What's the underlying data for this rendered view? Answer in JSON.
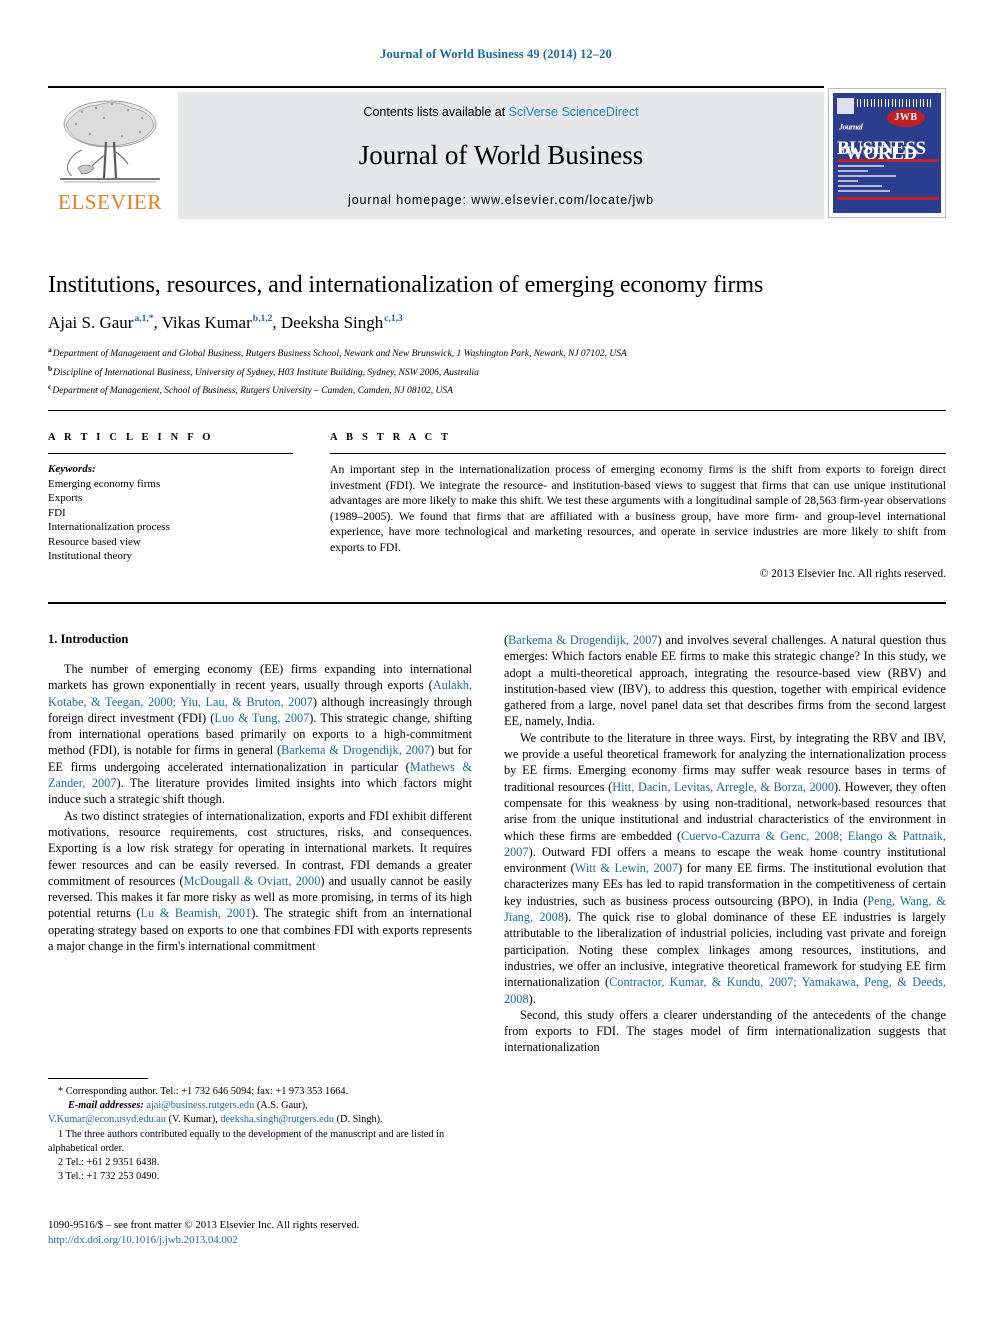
{
  "running_head": "Journal of World Business 49 (2014) 12–20",
  "masthead": {
    "contents_prefix": "Contents lists available at ",
    "sciencedirect": "SciVerse ScienceDirect",
    "journal_title": "Journal of World Business",
    "homepage": "journal homepage: www.elsevier.com/locate/jwb",
    "publisher_logo_text": "ELSEVIER",
    "cover": {
      "badge": "JWB",
      "word1_small": "Journal of",
      "word1": "WORLD",
      "word2": "BUSINESS"
    }
  },
  "article": {
    "title": "Institutions, resources, and internationalization of emerging economy firms",
    "authors": [
      {
        "name": "Ajai S. Gaur",
        "sup": "a,1,*"
      },
      {
        "name": "Vikas Kumar",
        "sup": "b,1,2"
      },
      {
        "name": "Deeksha Singh",
        "sup": "c,1,3"
      }
    ],
    "affiliations": [
      {
        "marker": "a",
        "text": "Department of Management and Global Business, Rutgers Business School, Newark and New Brunswick, 1 Washington Park, Newark, NJ 07102, USA"
      },
      {
        "marker": "b",
        "text": "Discipline of International Business, University of Sydney, H03 Institute Building, Sydney, NSW 2006, Australia"
      },
      {
        "marker": "c",
        "text": "Department of Management, School of Business, Rutgers University – Camden, Camden, NJ 08102, USA"
      }
    ]
  },
  "article_info": {
    "heading": "A R T I C L E    I N F O",
    "keywords_label": "Keywords:",
    "keywords": [
      "Emerging economy firms",
      "Exports",
      "FDI",
      "Internationalization process",
      "Resource based view",
      "Institutional theory"
    ]
  },
  "abstract": {
    "heading": "A B S T R A C T",
    "text": "An important step in the internationalization process of emerging economy firms is the shift from exports to foreign direct investment (FDI). We integrate the resource- and institution-based views to suggest that firms that can use unique institutional advantages are more likely to make this shift. We test these arguments with a longitudinal sample of 28,563 firm-year observations (1989–2005). We found that firms that are affiliated with a business group, have more firm- and group-level international experience, have more technological and marketing resources, and operate in service industries are more likely to shift from exports to FDI.",
    "copyright": "© 2013 Elsevier Inc. All rights reserved."
  },
  "body": {
    "section_heading": "1. Introduction",
    "left_paragraphs": [
      "The number of emerging economy (EE) firms expanding into international markets has grown exponentially in recent years, usually through exports (Aulakh, Kotabe, & Teegan, 2000; Yiu, Lau, & Bruton, 2007) although increasingly through foreign direct investment (FDI) (Luo & Tung, 2007). This strategic change, shifting from international operations based primarily on exports to a high-commitment method (FDI), is notable for firms in general (Barkema & Drogendijk, 2007) but for EE firms undergoing accelerated internationalization in particular (Mathews & Zander, 2007). The literature provides limited insights into which factors might induce such a strategic shift though.",
      "As two distinct strategies of internationalization, exports and FDI exhibit different motivations, resource requirements, cost structures, risks, and consequences. Exporting is a low risk strategy for operating in international markets. It requires fewer resources and can be easily reversed. In contrast, FDI demands a greater commitment of resources (McDougall & Oviatt, 2000) and usually cannot be easily reversed. This makes it far more risky as well as more promising, in terms of its high potential returns (Lu & Beamish, 2001). The strategic shift from an international operating strategy based on exports to one that combines FDI with exports represents a major change in the firm's international commitment"
    ],
    "right_paragraphs": [
      "(Barkema & Drogendijk, 2007) and involves several challenges. A natural question thus emerges: Which factors enable EE firms to make this strategic change? In this study, we adopt a multi-theoretical approach, integrating the resource-based view (RBV) and institution-based view (IBV), to address this question, together with empirical evidence gathered from a large, novel panel data set that describes firms from the second largest EE, namely, India.",
      "We contribute to the literature in three ways. First, by integrating the RBV and IBV, we provide a useful theoretical framework for analyzing the internationalization process by EE firms. Emerging economy firms may suffer weak resource bases in terms of traditional resources (Hitt, Dacin, Levitas, Arregle, & Borza, 2000). However, they often compensate for this weakness by using non-traditional, network-based resources that arise from the unique institutional and industrial characteristics of the environment in which these firms are embedded (Cuervo-Cazurra & Genc, 2008; Elango & Pattnaik, 2007). Outward FDI offers a means to escape the weak home country institutional environment (Witt & Lewin, 2007) for many EE firms. The institutional evolution that characterizes many EEs has led to rapid transformation in the competitiveness of certain key industries, such as business process outsourcing (BPO), in India (Peng, Wang, & Jiang, 2008). The quick rise to global dominance of these EE industries is largely attributable to the liberalization of industrial policies, including vast private and foreign participation. Noting these complex linkages among resources, institutions, and industries, we offer an inclusive, integrative theoretical framework for studying EE firm internationalization (Contractor, Kumar, & Kundu, 2007; Yamakawa, Peng, & Deeds, 2008).",
      "Second, this study offers a clearer understanding of the antecedents of the change from exports to FDI. The stages model of firm internationalization suggests that internationalization"
    ]
  },
  "footnotes": {
    "corresponding": "* Corresponding author. Tel.: +1 732 646 5094; fax: +1 973 353 1664.",
    "email_label": "E-mail addresses:",
    "emails": [
      {
        "address": "ajai@business.rutgers.edu",
        "owner": "(A.S. Gaur),"
      },
      {
        "address": "V.Kumar@econ.usyd.edu.au",
        "owner": "(V. Kumar),"
      },
      {
        "address": "deeksha.singh@rutgers.edu",
        "owner": "(D. Singh)."
      }
    ],
    "note1": "1 The three authors contributed equally to the development of the manuscript and are listed in alphabetical order.",
    "note2": "2 Tel.: +61 2 9351 6438.",
    "note3": "3 Tel.: +1 732 253 0490."
  },
  "imprint": {
    "line1": "1090-9516/$ – see front matter © 2013 Elsevier Inc. All rights reserved.",
    "doi": "http://dx.doi.org/10.1016/j.jwb.2013.04.002"
  },
  "colors": {
    "link_blue": "#1b6a99",
    "sciencedirect_blue": "#2389c4",
    "elsevier_orange": "#e87d1e",
    "cover_blue": "#2b3d8f",
    "cover_red": "#c12026",
    "banner_gray": "#e6e7e8"
  }
}
